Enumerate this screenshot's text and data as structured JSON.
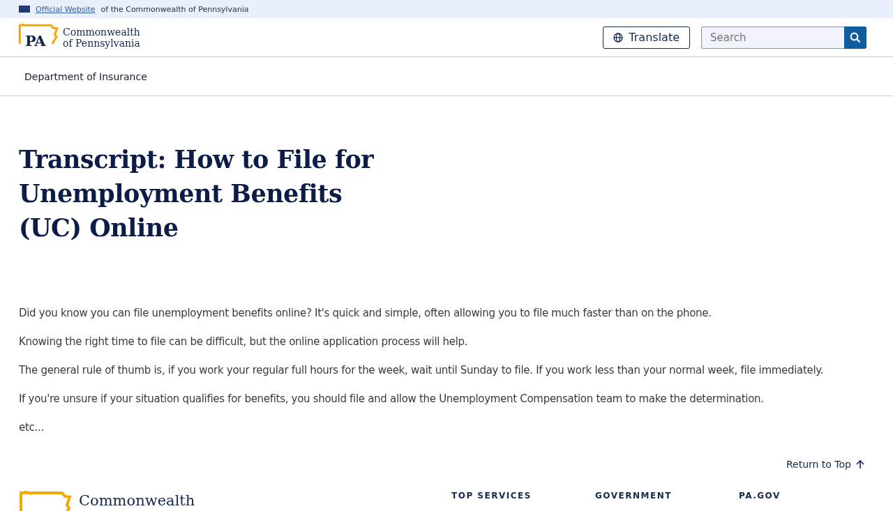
{
  "banner": {
    "link": "Official Website",
    "text": "of the Commonwealth of Pennsylvania"
  },
  "header": {
    "logo_mark": "PA",
    "logo_line1": "Commonwealth",
    "logo_line2": "of Pennsylvania",
    "translate": "Translate",
    "search": {
      "placeholder": "Search"
    }
  },
  "nav": {
    "title": "Department of Insurance"
  },
  "title": "Transcript: How to File for Unemployment Benefits (UC) Online",
  "paragraphs": [
    "Did you know you can file unemployment benefits online? It's quick and simple, often allowing you to file much faster than on the phone.",
    "Knowing the right time to file can be difficult, but the online application process will help.",
    "The general rule of thumb is, if you work your regular full hours for the week, wait until Sunday to file. If you work less than your normal week, file immediately.",
    "If you're unsure if your situation qualifies for benefits, you should file and allow the Unemployment Compensation team to make the determination.",
    "etc..."
  ],
  "return_to_top": "Return to Top",
  "footer": {
    "logo_line1": "Commonwealth",
    "headings": [
      "TOP SERVICES",
      "GOVERNMENT",
      "PA.GOV"
    ]
  }
}
